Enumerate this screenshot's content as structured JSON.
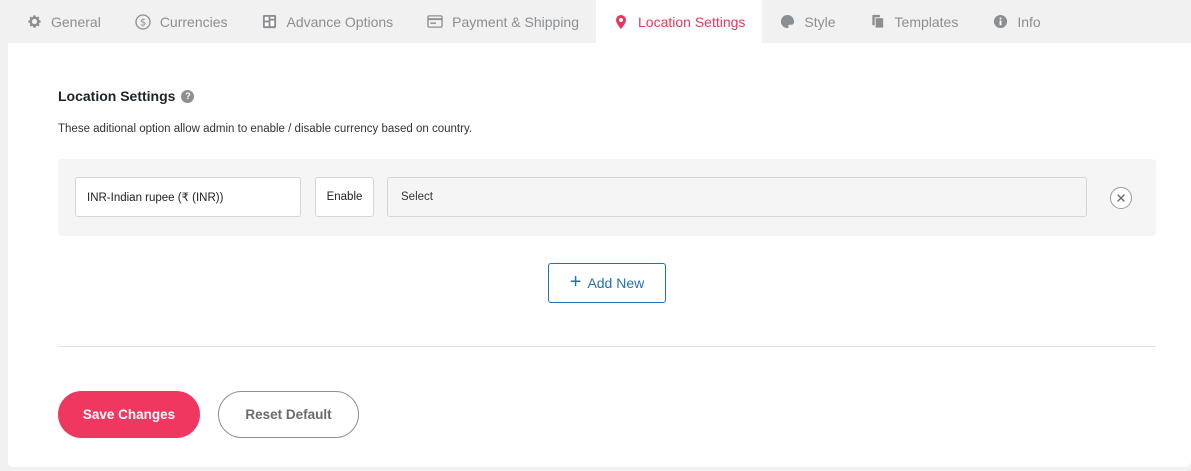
{
  "tabs": [
    {
      "label": "General",
      "icon": "gear-icon"
    },
    {
      "label": "Currencies",
      "icon": "dollar-circle-icon"
    },
    {
      "label": "Advance Options",
      "icon": "grid-icon"
    },
    {
      "label": "Payment & Shipping",
      "icon": "card-icon"
    },
    {
      "label": "Location Settings",
      "icon": "map-pin-icon"
    },
    {
      "label": "Style",
      "icon": "palette-icon"
    },
    {
      "label": "Templates",
      "icon": "copy-icon"
    },
    {
      "label": "Info",
      "icon": "info-icon"
    }
  ],
  "active_tab": "Location Settings",
  "section": {
    "title": "Location Settings",
    "description": "These aditional option allow admin to enable / disable currency based on country."
  },
  "rule": {
    "currency": "INR-Indian rupee (₹ (INR))",
    "status": "Enable",
    "countries_placeholder": "Select"
  },
  "buttons": {
    "add_new": "Add New",
    "save": "Save Changes",
    "reset": "Reset Default"
  },
  "colors": {
    "accent": "#e8365d",
    "save_button": "#f0375f",
    "link_blue": "#2271b1"
  }
}
